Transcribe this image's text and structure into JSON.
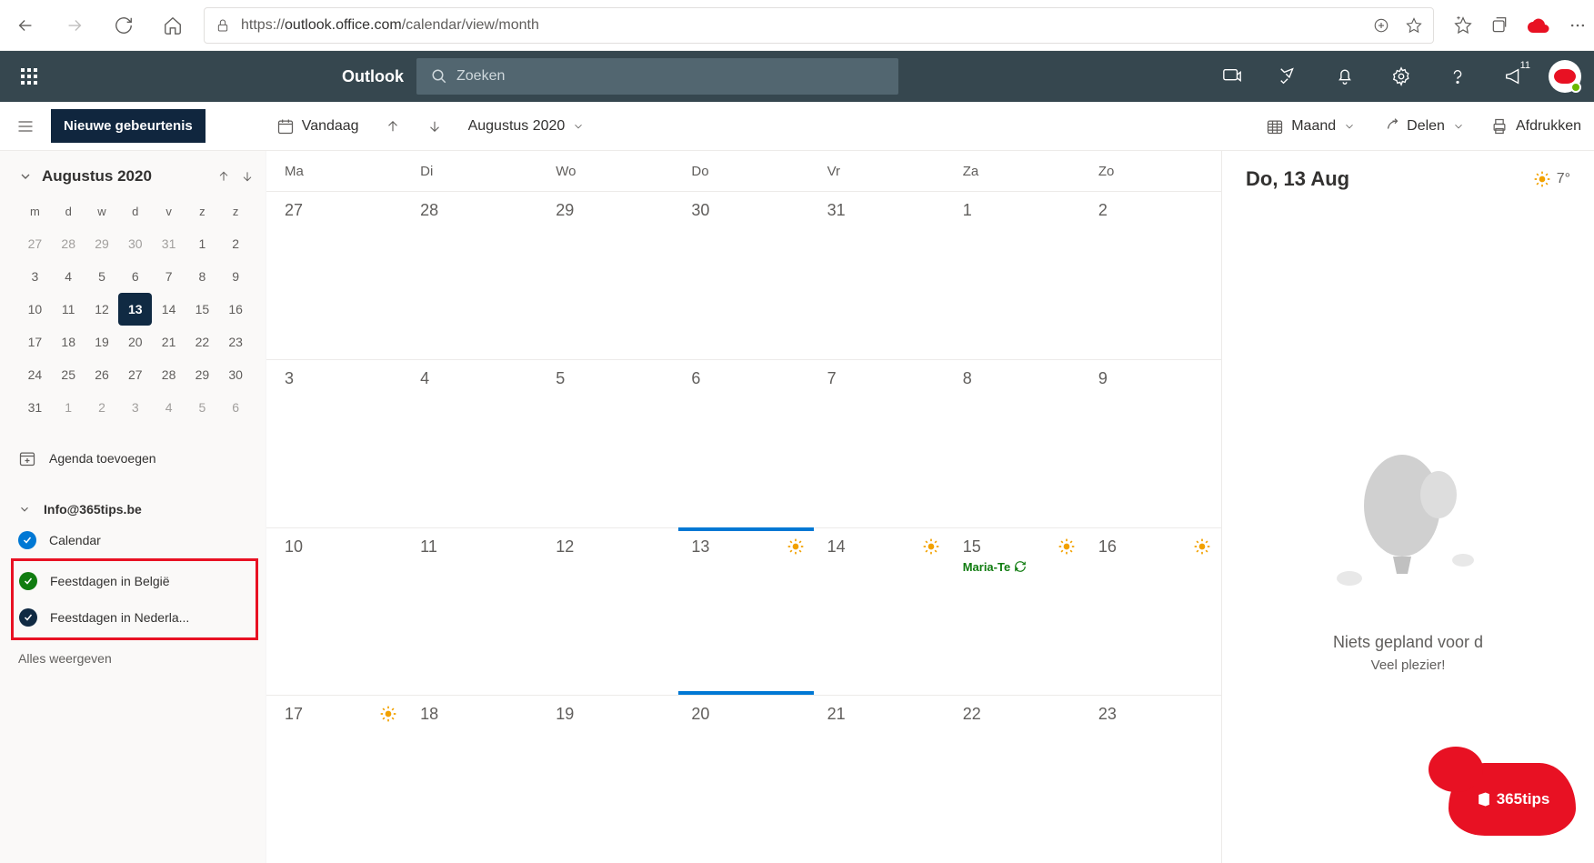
{
  "browser": {
    "url_prefix": "https://",
    "url_domain": "outlook.office.com",
    "url_path": "/calendar/view/month"
  },
  "header": {
    "app_name": "Outlook",
    "search_placeholder": "Zoeken",
    "notification_count": "11"
  },
  "cmd": {
    "new_event": "Nieuwe gebeurtenis",
    "today": "Vandaag",
    "month_label": "Augustus 2020",
    "view_label": "Maand",
    "share": "Delen",
    "print": "Afdrukken"
  },
  "mini_cal": {
    "title": "Augustus 2020",
    "weekdays": [
      "m",
      "d",
      "w",
      "d",
      "v",
      "z",
      "z"
    ],
    "rows": [
      [
        "27",
        "28",
        "29",
        "30",
        "31",
        "1",
        "2"
      ],
      [
        "3",
        "4",
        "5",
        "6",
        "7",
        "8",
        "9"
      ],
      [
        "10",
        "11",
        "12",
        "13",
        "14",
        "15",
        "16"
      ],
      [
        "17",
        "18",
        "19",
        "20",
        "21",
        "22",
        "23"
      ],
      [
        "24",
        "25",
        "26",
        "27",
        "28",
        "29",
        "30"
      ],
      [
        "31",
        "1",
        "2",
        "3",
        "4",
        "5",
        "6"
      ]
    ],
    "today": "13"
  },
  "sidebar": {
    "add_calendar": "Agenda toevoegen",
    "account": "Info@365tips.be",
    "cal_calendar": "Calendar",
    "cal_be": "Feestdagen in België",
    "cal_nl": "Feestdagen in Nederla...",
    "show_all": "Alles weergeven"
  },
  "month": {
    "weekdays": [
      "Ma",
      "Di",
      "Wo",
      "Do",
      "Vr",
      "Za",
      "Zo"
    ],
    "rows": [
      {
        "days": [
          "27",
          "28",
          "29",
          "30",
          "31",
          "1",
          "2"
        ],
        "weather": [],
        "events": {}
      },
      {
        "days": [
          "3",
          "4",
          "5",
          "6",
          "7",
          "8",
          "9"
        ],
        "weather": [],
        "events": {}
      },
      {
        "days": [
          "10",
          "11",
          "12",
          "13",
          "14",
          "15",
          "16"
        ],
        "weather": [
          3,
          4,
          5,
          6
        ],
        "events": {
          "5": "Maria-Te"
        }
      },
      {
        "days": [
          "17",
          "18",
          "19",
          "20",
          "21",
          "22",
          "23"
        ],
        "weather": [
          0
        ],
        "events": {}
      }
    ],
    "today_row": 2,
    "today_col": 3
  },
  "right_pane": {
    "title": "Do, 13 Aug",
    "temp": "7°",
    "empty_title": "Niets gepland voor d",
    "empty_sub": "Veel plezier!"
  },
  "logo_text": "365tips"
}
